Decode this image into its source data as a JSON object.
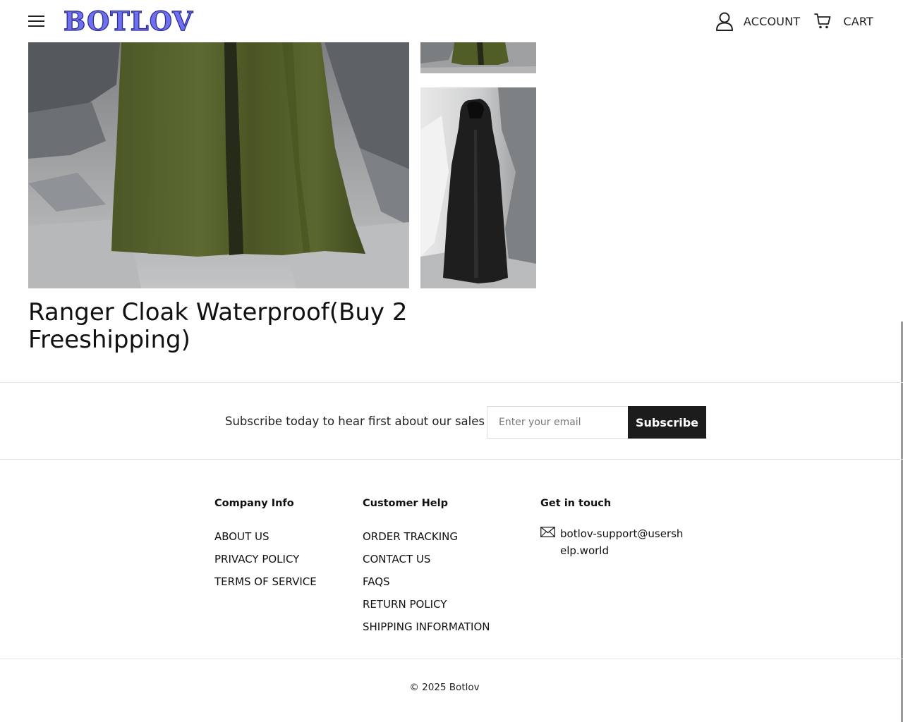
{
  "header": {
    "menu_icon": "hamburger-menu-icon",
    "logo_text": "BOTLOV",
    "account_label": "ACCOUNT",
    "account_icon": "user-icon",
    "cart_label": "CART",
    "cart_icon": "shopping-cart-icon"
  },
  "product": {
    "title": "Ranger Cloak Waterproof(Buy 2 Freeshipping)",
    "images": [
      {
        "name": "main-image",
        "subject": "olive green hooded cloak on rocky ground"
      },
      {
        "name": "thumbnail-1",
        "subject": "green cloak hem"
      },
      {
        "name": "thumbnail-2",
        "subject": "black hooded cloak in rocky landscape"
      }
    ]
  },
  "subscribe": {
    "text": "Subscribe today to hear first about our sales",
    "placeholder": "Enter your email",
    "button_label": "Subscribe"
  },
  "footer": {
    "company": {
      "heading": "Company Info",
      "links": [
        "ABOUT US",
        "PRIVACY POLICY",
        "TERMS OF SERVICE"
      ]
    },
    "help": {
      "heading": "Customer Help",
      "links": [
        "ORDER TRACKING",
        "CONTACT US",
        "FAQS",
        "RETURN POLICY",
        "SHIPPING INFORMATION"
      ]
    },
    "touch": {
      "heading": "Get in touch",
      "email_icon": "envelope-icon",
      "email": "botlov-support@usershelp.world"
    },
    "copyright": "© 2025 Botlov"
  },
  "colors": {
    "logo_fill": "#6f6ff2",
    "logo_outline": "#2b2e8e",
    "button_bg": "#1c1c1c",
    "cloak_green": "#55622f",
    "cloak_black": "#1e1e1e"
  }
}
